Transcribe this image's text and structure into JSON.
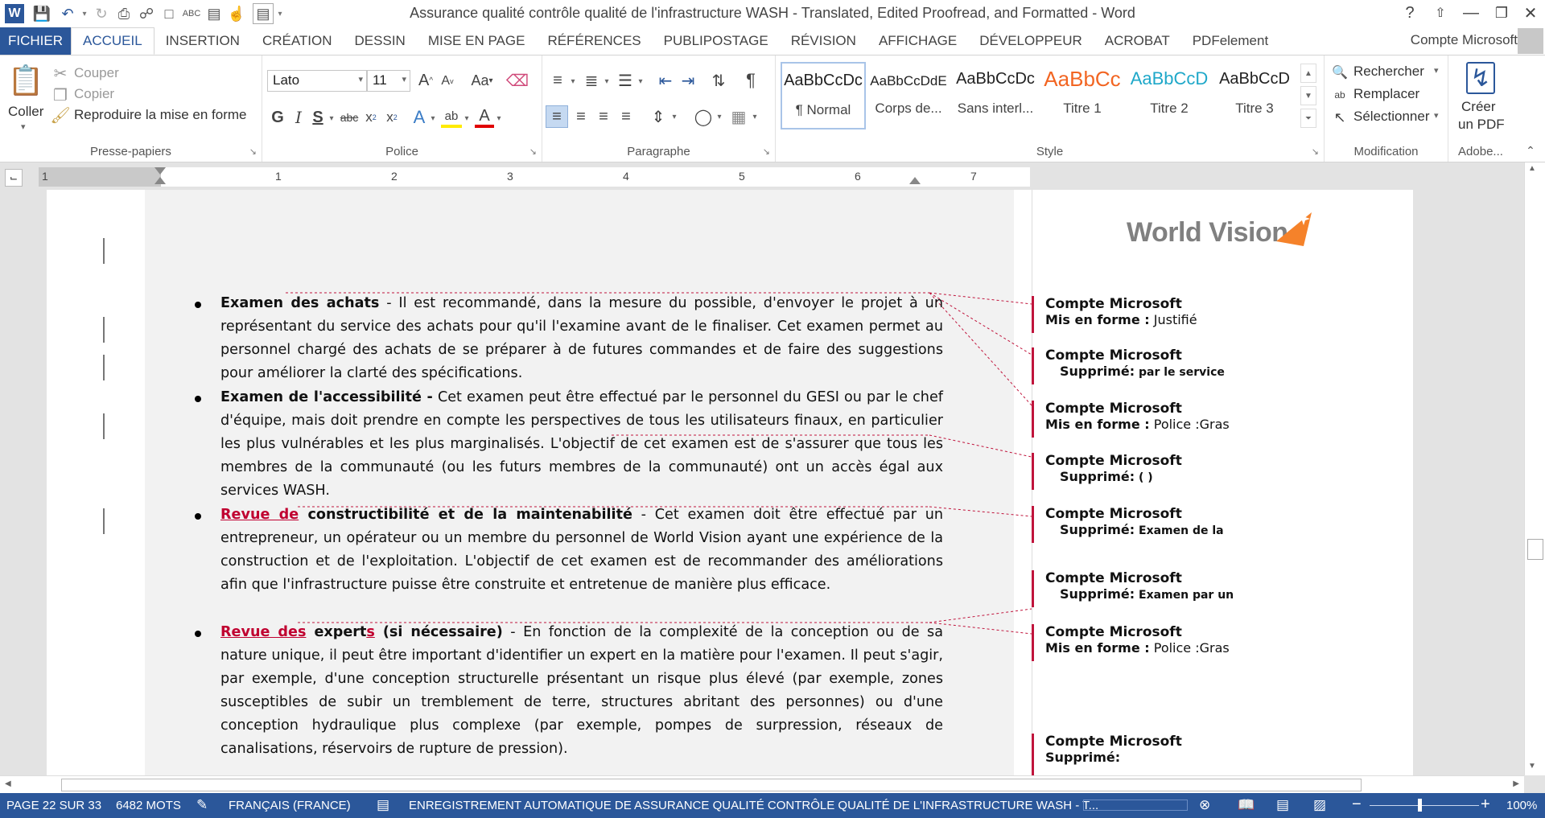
{
  "window": {
    "title": "Assurance qualité  contrôle qualité de l'infrastructure WASH - Translated, Edited Proofread, and Formatted - Word",
    "help": "?"
  },
  "tabs": [
    "FICHIER",
    "ACCUEIL",
    "INSERTION",
    "CRÉATION",
    "DESSIN",
    "MISE EN PAGE",
    "RÉFÉRENCES",
    "PUBLIPOSTAGE",
    "RÉVISION",
    "AFFICHAGE",
    "DÉVELOPPEUR",
    "ACROBAT",
    "PDFelement"
  ],
  "active_tab": "ACCUEIL",
  "account": "Compte Microsoft",
  "ribbon": {
    "clipboard": {
      "paste": "Coller",
      "cut": "Couper",
      "copy": "Copier",
      "format_painter": "Reproduire la mise en forme",
      "label": "Presse-papiers"
    },
    "font": {
      "family": "Lato",
      "size": "11",
      "label": "Police",
      "change_case": "Aa"
    },
    "paragraph": {
      "label": "Paragraphe"
    },
    "styles": {
      "label": "Style",
      "items": [
        {
          "sample": "AaBbCcDc",
          "name": "¶ Normal",
          "color": "#111111"
        },
        {
          "sample": "AaBbCcDdE",
          "name": "Corps de...",
          "color": "#111111"
        },
        {
          "sample": "AaBbCcDc",
          "name": "Sans interl...",
          "color": "#111111"
        },
        {
          "sample": "AaBbCc",
          "name": "Titre 1",
          "color": "#f26522"
        },
        {
          "sample": "AaBbCcD",
          "name": "Titre 2",
          "color": "#1fa8c9"
        },
        {
          "sample": "AaBbCcD",
          "name": "Titre 3",
          "color": "#111111"
        }
      ]
    },
    "editing": {
      "label": "Modification",
      "find": "Rechercher",
      "replace": "Remplacer",
      "select": "Sélectionner"
    },
    "adobe": {
      "label": "Adobe...",
      "create_pdf_line1": "Créer",
      "create_pdf_line2": "un PDF"
    }
  },
  "ruler": {
    "numbers": [
      "1",
      "1",
      "2",
      "3",
      "4",
      "5",
      "6",
      "7"
    ]
  },
  "document": {
    "bullets": [
      {
        "title": "Examen des achats",
        "text": " - Il est recommandé, dans la mesure du possible, d'envoyer le projet à un représentant du service des achats pour qu'il l'examine avant de le finaliser. Cet examen permet au personnel chargé des achats de se préparer à de futures commandes et de faire des suggestions pour améliorer la clarté des spécifications."
      },
      {
        "title": "Examen de l'accessibilité -",
        "text": " Cet examen peut être effectué par le personnel du GESI ou par le chef d'équipe, mais doit prendre en compte les perspectives de tous les utilisateurs finaux, en particulier les plus vulnérables et les plus marginalisés. L'objectif de cet examen est de s'assurer que tous les membres de la communauté (ou les futurs membres de la communauté) ont un accès égal aux services WASH."
      },
      {
        "inserted": "Revue de",
        "title": " constructibilité et de la maintenabilité",
        "text": " - Cet examen doit être effectué par un entrepreneur, un opérateur ou un membre du personnel de World Vision ayant une expérience de la construction et de l'exploitation. L'objectif de cet examen est de recommander des améliorations afin que l'infrastructure puisse être construite et entretenue de manière plus efficace."
      },
      {
        "inserted": "Revue des",
        "title": " expert",
        "inserted2": "s",
        "title2": " (si nécessaire)",
        "text": " - En fonction de la complexité de la conception ou de sa nature unique, il peut être important d'identifier un expert en la matière pour l'examen. Il peut s'agir, par exemple, d'une conception structurelle présentant un risque plus élevé (par exemple, zones susceptibles de subir un tremblement de terre, structures abritant des personnes) ou d'une conception hydraulique plus complexe (par exemple, pompes de surpression, réseaux de canalisations, réservoirs de rupture de pression)."
      }
    ],
    "logo": "World Vision",
    "comments": [
      {
        "author": "Compte Microsoft",
        "label": "Mis en forme :",
        "value": " Justifié",
        "type": "format"
      },
      {
        "author": "Compte Microsoft",
        "label": "Supprimé:",
        "value": " par le service",
        "type": "delete"
      },
      {
        "author": "Compte Microsoft",
        "label": "Mis en forme :",
        "value": " Police :Gras",
        "type": "format"
      },
      {
        "author": "Compte Microsoft",
        "label": "Supprimé:",
        "value": "  ( )",
        "type": "delete"
      },
      {
        "author": "Compte Microsoft",
        "label": "Supprimé:",
        "value": " Examen de la",
        "type": "delete"
      },
      {
        "author": "Compte Microsoft",
        "label": "Supprimé:",
        "value": " Examen par un",
        "type": "delete"
      },
      {
        "author": "Compte Microsoft",
        "label": "Mis en forme :",
        "value": " Police :Gras",
        "type": "format"
      },
      {
        "author": "Compte Microsoft",
        "label": "Supprimé:",
        "value": "",
        "type": "delete"
      }
    ]
  },
  "statusbar": {
    "page": "PAGE 22 SUR 33",
    "words": "6482 MOTS",
    "language": "FRANÇAIS (FRANCE)",
    "autosave": "ENREGISTREMENT AUTOMATIQUE DE ASSURANCE QUALITÉ  CONTRÔLE QUALITÉ DE L'INFRASTRUCTURE WASH - T...",
    "zoom": "100%"
  },
  "colors": {
    "accent": "#2b579a",
    "revision": "#c0143c",
    "logo_orange": "#f5822a"
  }
}
